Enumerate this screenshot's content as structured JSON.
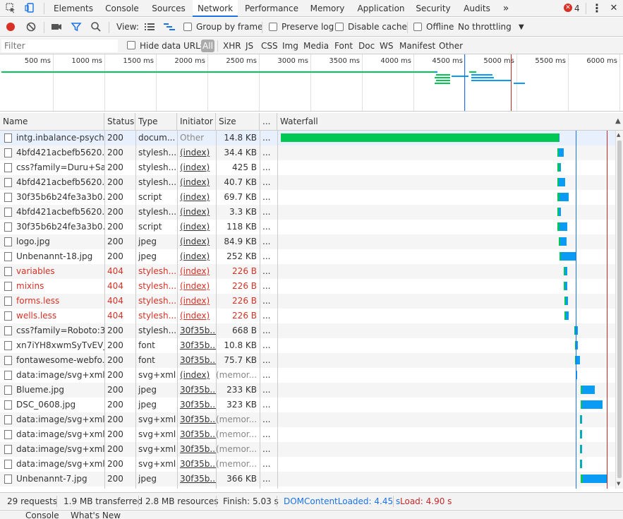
{
  "tabs": [
    "Elements",
    "Console",
    "Sources",
    "Network",
    "Performance",
    "Memory",
    "Application",
    "Security",
    "Audits"
  ],
  "active_tab": "Network",
  "more_tabs_glyph": "»",
  "error_count": "4",
  "menu_glyph": "⋮",
  "close_glyph": "✕",
  "toolbar": {
    "view_label": "View:",
    "group_by_frame": "Group by frame",
    "preserve_log": "Preserve log",
    "disable_cache": "Disable cache",
    "offline": "Offline",
    "throttling": "No throttling"
  },
  "filter": {
    "placeholder": "Filter",
    "hide_data_urls": "Hide data URLs",
    "all": "All",
    "types": [
      "XHR",
      "JS",
      "CSS",
      "Img",
      "Media",
      "Font",
      "Doc",
      "WS",
      "Manifest",
      "Other"
    ]
  },
  "overview_ticks": [
    "500 ms",
    "1000 ms",
    "1500 ms",
    "2000 ms",
    "2500 ms",
    "3000 ms",
    "3500 ms",
    "4000 ms",
    "4500 ms",
    "5000 ms",
    "5500 ms",
    "6000 ms"
  ],
  "columns": {
    "name": "Name",
    "status": "Status",
    "type": "Type",
    "initiator": "Initiator",
    "size": "Size",
    "time": "...",
    "waterfall": "Waterfall"
  },
  "rows": [
    {
      "name": "intg.inbalance-psych...",
      "status": "200",
      "type": "docum...",
      "initiator": "Other",
      "size": "14.8 KB",
      "error": false,
      "link": false
    },
    {
      "name": "4bfd421acbefb5620...",
      "status": "200",
      "type": "stylesh...",
      "initiator": "(index)",
      "size": "34.4 KB",
      "error": false,
      "link": true
    },
    {
      "name": "css?family=Duru+Sa...",
      "status": "200",
      "type": "stylesh...",
      "initiator": "(index)",
      "size": "425 B",
      "error": false,
      "link": true
    },
    {
      "name": "4bfd421acbefb5620...",
      "status": "200",
      "type": "stylesh...",
      "initiator": "(index)",
      "size": "40.7 KB",
      "error": false,
      "link": true
    },
    {
      "name": "30f35b6b24fe3a3b0...",
      "status": "200",
      "type": "script",
      "initiator": "(index)",
      "size": "69.7 KB",
      "error": false,
      "link": true
    },
    {
      "name": "4bfd421acbefb5620...",
      "status": "200",
      "type": "stylesh...",
      "initiator": "(index)",
      "size": "3.3 KB",
      "error": false,
      "link": true
    },
    {
      "name": "30f35b6b24fe3a3b0...",
      "status": "200",
      "type": "script",
      "initiator": "(index)",
      "size": "118 KB",
      "error": false,
      "link": true
    },
    {
      "name": "logo.jpg",
      "status": "200",
      "type": "jpeg",
      "initiator": "(index)",
      "size": "84.9 KB",
      "error": false,
      "link": true
    },
    {
      "name": "Unbenannt-18.jpg",
      "status": "200",
      "type": "jpeg",
      "initiator": "(index)",
      "size": "252 KB",
      "error": false,
      "link": true
    },
    {
      "name": "variables",
      "status": "404",
      "type": "stylesh...",
      "initiator": "(index)",
      "size": "226 B",
      "error": true,
      "link": true
    },
    {
      "name": "mixins",
      "status": "404",
      "type": "stylesh...",
      "initiator": "(index)",
      "size": "226 B",
      "error": true,
      "link": true
    },
    {
      "name": "forms.less",
      "status": "404",
      "type": "stylesh...",
      "initiator": "(index)",
      "size": "226 B",
      "error": true,
      "link": true
    },
    {
      "name": "wells.less",
      "status": "404",
      "type": "stylesh...",
      "initiator": "(index)",
      "size": "226 B",
      "error": true,
      "link": true
    },
    {
      "name": "css?family=Roboto:3...",
      "status": "200",
      "type": "stylesh...",
      "initiator": "30f35b...",
      "size": "668 B",
      "error": false,
      "link": true
    },
    {
      "name": "xn7iYH8xwmSyTvEV_...",
      "status": "200",
      "type": "font",
      "initiator": "30f35b...",
      "size": "10.8 KB",
      "error": false,
      "link": true
    },
    {
      "name": "fontawesome-webfo...",
      "status": "200",
      "type": "font",
      "initiator": "30f35b...",
      "size": "75.7 KB",
      "error": false,
      "link": true
    },
    {
      "name": "data:image/svg+xml;...",
      "status": "200",
      "type": "svg+xml",
      "initiator": "(index)",
      "size": "(memor...",
      "error": false,
      "link": true
    },
    {
      "name": "Blueme.jpg",
      "status": "200",
      "type": "jpeg",
      "initiator": "30f35b...",
      "size": "233 KB",
      "error": false,
      "link": true
    },
    {
      "name": "DSC_0608.jpg",
      "status": "200",
      "type": "jpeg",
      "initiator": "30f35b...",
      "size": "323 KB",
      "error": false,
      "link": true
    },
    {
      "name": "data:image/svg+xml;...",
      "status": "200",
      "type": "svg+xml",
      "initiator": "30f35b...",
      "size": "(memor...",
      "error": false,
      "link": true
    },
    {
      "name": "data:image/svg+xml;...",
      "status": "200",
      "type": "svg+xml",
      "initiator": "30f35b...",
      "size": "(memor...",
      "error": false,
      "link": true
    },
    {
      "name": "data:image/svg+xml;...",
      "status": "200",
      "type": "svg+xml",
      "initiator": "30f35b...",
      "size": "(memor...",
      "error": false,
      "link": true
    },
    {
      "name": "data:image/svg+xml;...",
      "status": "200",
      "type": "svg+xml",
      "initiator": "30f35b...",
      "size": "(memor...",
      "error": false,
      "link": true
    },
    {
      "name": "Unbenannt-7.jpg",
      "status": "200",
      "type": "jpeg",
      "initiator": "30f35b...",
      "size": "366 KB",
      "error": false,
      "link": true
    }
  ],
  "status_bar": {
    "requests": "29 requests",
    "transferred": "1.9 MB transferred",
    "resources": "2.8 MB resources",
    "finish": "Finish: 5.03 s",
    "dom_content_loaded": "DOMContentLoaded: 4.45 s",
    "load": "Load: 4.90 s"
  },
  "drawer_tabs": [
    "Console",
    "What's New"
  ],
  "colors": {
    "accent": "#1a73e8",
    "error": "#d93025",
    "waiting": "#00c853",
    "download": "#0a9cf5",
    "dcl_line": "#1a73e8",
    "load_line": "#c62828"
  }
}
